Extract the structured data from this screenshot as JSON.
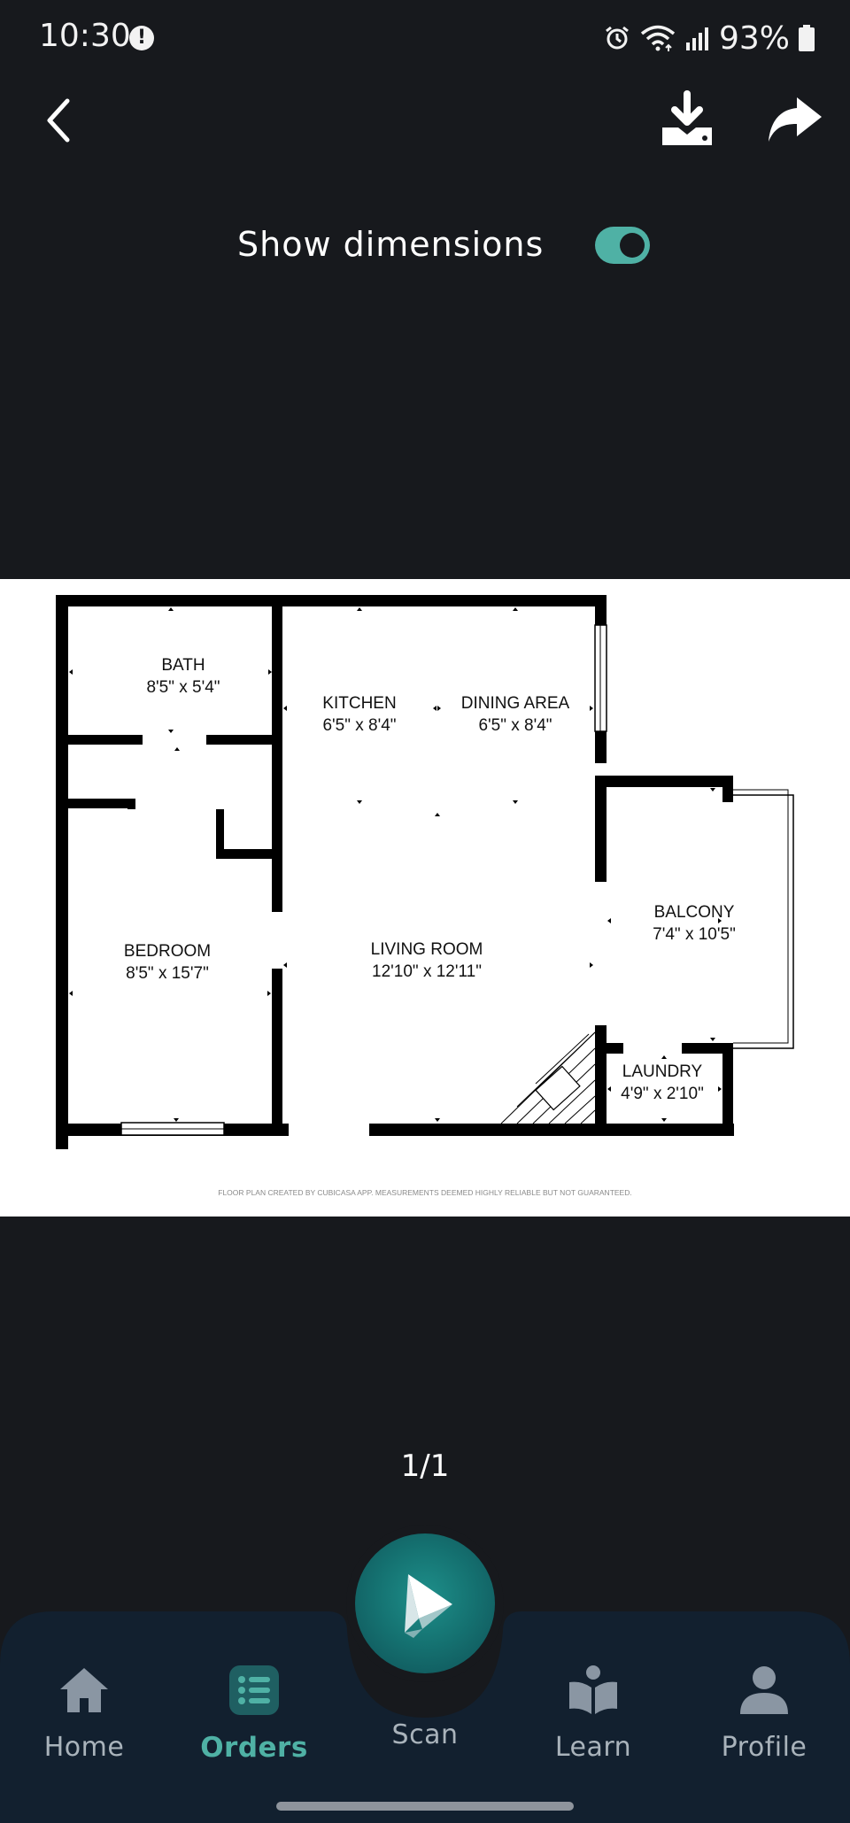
{
  "status_bar": {
    "time": "10:30",
    "alert_glyph": "!",
    "battery": "93%",
    "icons": [
      "alarm-icon",
      "wifi-icon",
      "signal-icon",
      "battery-icon"
    ]
  },
  "header": {
    "show_dimensions_label": "Show dimensions",
    "show_dimensions_enabled": true
  },
  "floor_plan": {
    "rooms": [
      {
        "name": "BATH",
        "size": "8'5\" x 5'4\""
      },
      {
        "name": "KITCHEN",
        "size": "6'5\" x 8'4\""
      },
      {
        "name": "DINING AREA",
        "size": "6'5\" x 8'4\""
      },
      {
        "name": "BALCONY",
        "size": "7'4\" x 10'5\""
      },
      {
        "name": "BEDROOM",
        "size": "8'5\" x 15'7\""
      },
      {
        "name": "LIVING ROOM",
        "size": "12'10\" x 12'11\""
      },
      {
        "name": "LAUNDRY",
        "size": "4'9\" x 2'10\""
      }
    ],
    "disclaimer": "FLOOR PLAN CREATED BY CUBICASA APP. MEASUREMENTS DEEMED HIGHLY RELIABLE BUT NOT GUARANTEED."
  },
  "pagination": {
    "label": "1/1"
  },
  "nav": {
    "home": "Home",
    "orders": "Orders",
    "scan": "Scan",
    "learn": "Learn",
    "profile": "Profile",
    "active": "orders"
  },
  "colors": {
    "background": "#17191d",
    "accent": "#4fb1a5",
    "nav_background": "#12202f",
    "nav_inactive": "#a9b3bb"
  }
}
